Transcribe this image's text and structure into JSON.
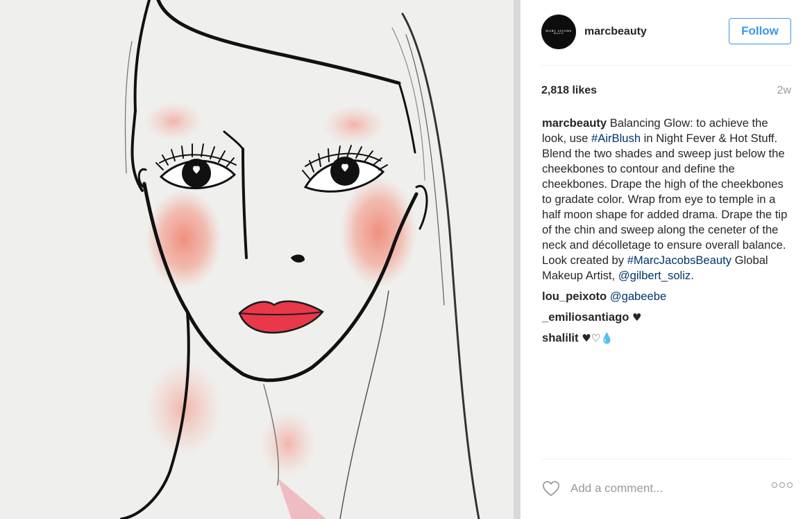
{
  "post": {
    "image_alt": "Illustrated face chart showing blush placement",
    "header": {
      "avatar_text": "MARC JACOBS",
      "avatar_subtext": "BEAUTY",
      "username": "marcbeauty",
      "follow_label": "Follow"
    },
    "likes": "2,818 likes",
    "time_ago": "2w",
    "caption": {
      "user": "marcbeauty",
      "part1": " Balancing Glow: to achieve the look, use ",
      "hashtag1": "#AirBlush",
      "part2": " in Night Fever & Hot Stuff. Blend the two shades and sweep just below the cheekbones to contour and define the cheekbones. Drape the high of the cheekbones to gradate color. Wrap from eye to temple in a half moon shape for added drama. Drape the tip of the chin and sweep along the ceneter of the neck and décolletage to ensure overall balance. Look created by ",
      "hashtag2": "#MarcJacobsBeauty",
      "part3": " Global Makeup Artist, ",
      "mention": "@gilbert_soliz",
      "part4": "."
    },
    "comments": [
      {
        "user": "lou_peixoto",
        "mention": "@gabeebe"
      },
      {
        "user": "_emiliosantiago",
        "emoji": "♥"
      },
      {
        "user": "shalilit",
        "emoji": "♥♡💧"
      }
    ],
    "comment_placeholder": "Add a comment...",
    "colors": {
      "accent_blue": "#3897f0",
      "link_blue": "#003569",
      "muted_gray": "#999999",
      "blush": "#f08a78",
      "lips": "#e8384a"
    },
    "icons": {
      "like": "heart-outline-icon",
      "more": "more-options-icon"
    }
  }
}
